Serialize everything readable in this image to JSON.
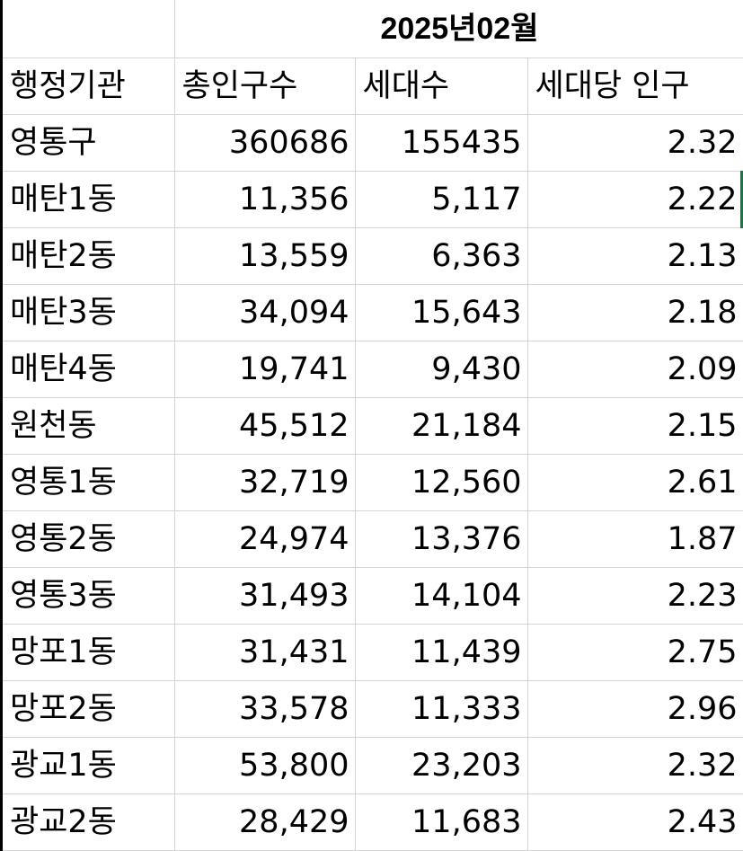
{
  "sheet": {
    "period_title": "2025년02월",
    "headers": [
      "행정기관",
      "총인구수",
      "세대수",
      "세대당 인구"
    ],
    "rows": [
      {
        "district": "영통구",
        "population": "360686",
        "households": "155435",
        "per_household": "2.32"
      },
      {
        "district": "매탄1동",
        "population": "11,356",
        "households": "5,117",
        "per_household": "2.22"
      },
      {
        "district": "매탄2동",
        "population": "13,559",
        "households": "6,363",
        "per_household": "2.13"
      },
      {
        "district": "매탄3동",
        "population": "34,094",
        "households": "15,643",
        "per_household": "2.18"
      },
      {
        "district": "매탄4동",
        "population": "19,741",
        "households": "9,430",
        "per_household": "2.09"
      },
      {
        "district": "원천동",
        "population": "45,512",
        "households": "21,184",
        "per_household": "2.15"
      },
      {
        "district": "영통1동",
        "population": "32,719",
        "households": "12,560",
        "per_household": "2.61"
      },
      {
        "district": "영통2동",
        "population": "24,974",
        "households": "13,376",
        "per_household": "1.87"
      },
      {
        "district": "영통3동",
        "population": "31,493",
        "households": "14,104",
        "per_household": "2.23"
      },
      {
        "district": "망포1동",
        "population": "31,431",
        "households": "11,439",
        "per_household": "2.75"
      },
      {
        "district": "망포2동",
        "population": "33,578",
        "households": "11,333",
        "per_household": "2.96"
      },
      {
        "district": "광교1동",
        "population": "53,800",
        "households": "23,203",
        "per_household": "2.32"
      },
      {
        "district": "광교2동",
        "population": "28,429",
        "households": "11,683",
        "per_household": "2.43"
      }
    ]
  },
  "colors": {
    "grid_line": "#d4d4d4",
    "selection_accent": "#217346",
    "text": "#000000"
  }
}
